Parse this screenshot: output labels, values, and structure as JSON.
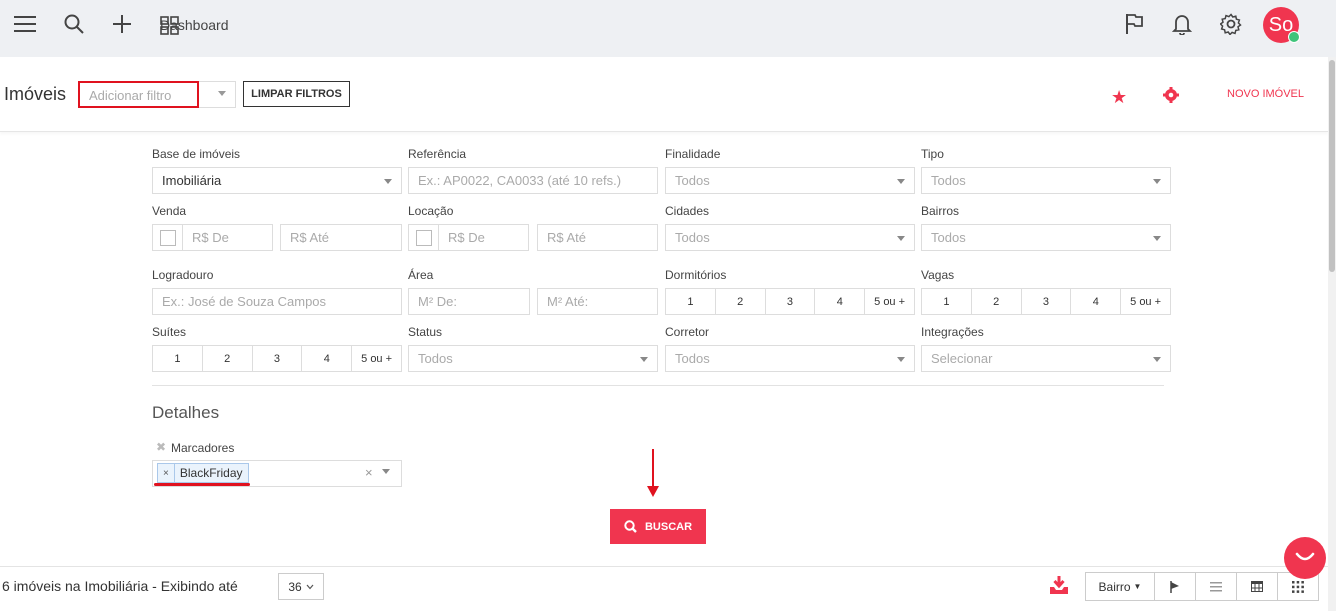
{
  "topbar": {
    "dashboard_label": "Dashboard",
    "avatar_initials": "So",
    "icons": [
      "menu-icon",
      "search-icon",
      "plus-icon",
      "grid-icon",
      "flag-icon",
      "bell-icon",
      "gear-icon"
    ]
  },
  "header": {
    "title": "Imóveis",
    "filter_placeholder": "Adicionar filtro",
    "clear_filters": "LIMPAR FILTROS",
    "new_property": "NOVO IMÓVEL"
  },
  "form": {
    "base": {
      "label": "Base de imóveis",
      "value": "Imobiliária"
    },
    "referencia": {
      "label": "Referência",
      "placeholder": "Ex.: AP0022, CA0033 (até 10 refs.)"
    },
    "finalidade": {
      "label": "Finalidade",
      "value": "Todos"
    },
    "tipo": {
      "label": "Tipo",
      "value": "Todos"
    },
    "venda": {
      "label": "Venda",
      "from": "R$ De",
      "to": "R$ Até"
    },
    "locacao": {
      "label": "Locação",
      "from": "R$ De",
      "to": "R$ Até"
    },
    "cidades": {
      "label": "Cidades",
      "value": "Todos"
    },
    "bairros": {
      "label": "Bairros",
      "value": "Todos"
    },
    "logradouro": {
      "label": "Logradouro",
      "placeholder": "Ex.: José de Souza Campos"
    },
    "area": {
      "label": "Área",
      "from": "M² De:",
      "to": "M² Até:"
    },
    "dormitorios": {
      "label": "Dormitórios",
      "options": [
        "1",
        "2",
        "3",
        "4",
        "5 ou +"
      ]
    },
    "vagas": {
      "label": "Vagas",
      "options": [
        "1",
        "2",
        "3",
        "4",
        "5 ou +"
      ]
    },
    "suites": {
      "label": "Suítes",
      "options": [
        "1",
        "2",
        "3",
        "4",
        "5 ou +"
      ]
    },
    "status": {
      "label": "Status",
      "value": "Todos"
    },
    "corretor": {
      "label": "Corretor",
      "value": "Todos"
    },
    "integracoes": {
      "label": "Integrações",
      "value": "Selecionar"
    }
  },
  "details": {
    "title": "Detalhes",
    "marcadores_label": "Marcadores",
    "tag": "BlackFriday",
    "tag_remove": "×",
    "clear": "×"
  },
  "search_button": "BUSCAR",
  "bottom": {
    "count_text": "6 imóveis na Imobiliária - Exibindo até",
    "per_page": "36",
    "sort_label": "Bairro"
  },
  "colors": {
    "accent": "#f0354f",
    "highlight": "#e0121f",
    "topbar": "#eef0f3"
  }
}
